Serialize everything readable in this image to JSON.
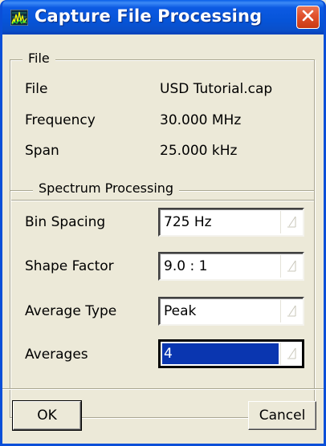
{
  "window": {
    "title": "Capture File Processing",
    "icon": "spectrum-app-icon",
    "close_icon": "close-icon"
  },
  "file_group": {
    "legend": "File",
    "rows": [
      {
        "label": "File",
        "value": "USD Tutorial.cap"
      },
      {
        "label": "Frequency",
        "value": "30.000 MHz"
      },
      {
        "label": "Span",
        "value": "25.000 kHz"
      }
    ]
  },
  "spectrum_group": {
    "legend": "Spectrum Processing",
    "fields": [
      {
        "label": "Bin Spacing",
        "value": "725 Hz"
      },
      {
        "label": "Shape Factor",
        "value": "9.0 : 1"
      },
      {
        "label": "Average Type",
        "value": "Peak"
      },
      {
        "label": "Averages",
        "value": "4"
      }
    ]
  },
  "buttons": {
    "ok": "OK",
    "cancel": "Cancel"
  },
  "colors": {
    "titlebar": "#0a5ee8",
    "close": "#e2532e",
    "selection": "#0a36b0",
    "face": "#ece9d8"
  }
}
